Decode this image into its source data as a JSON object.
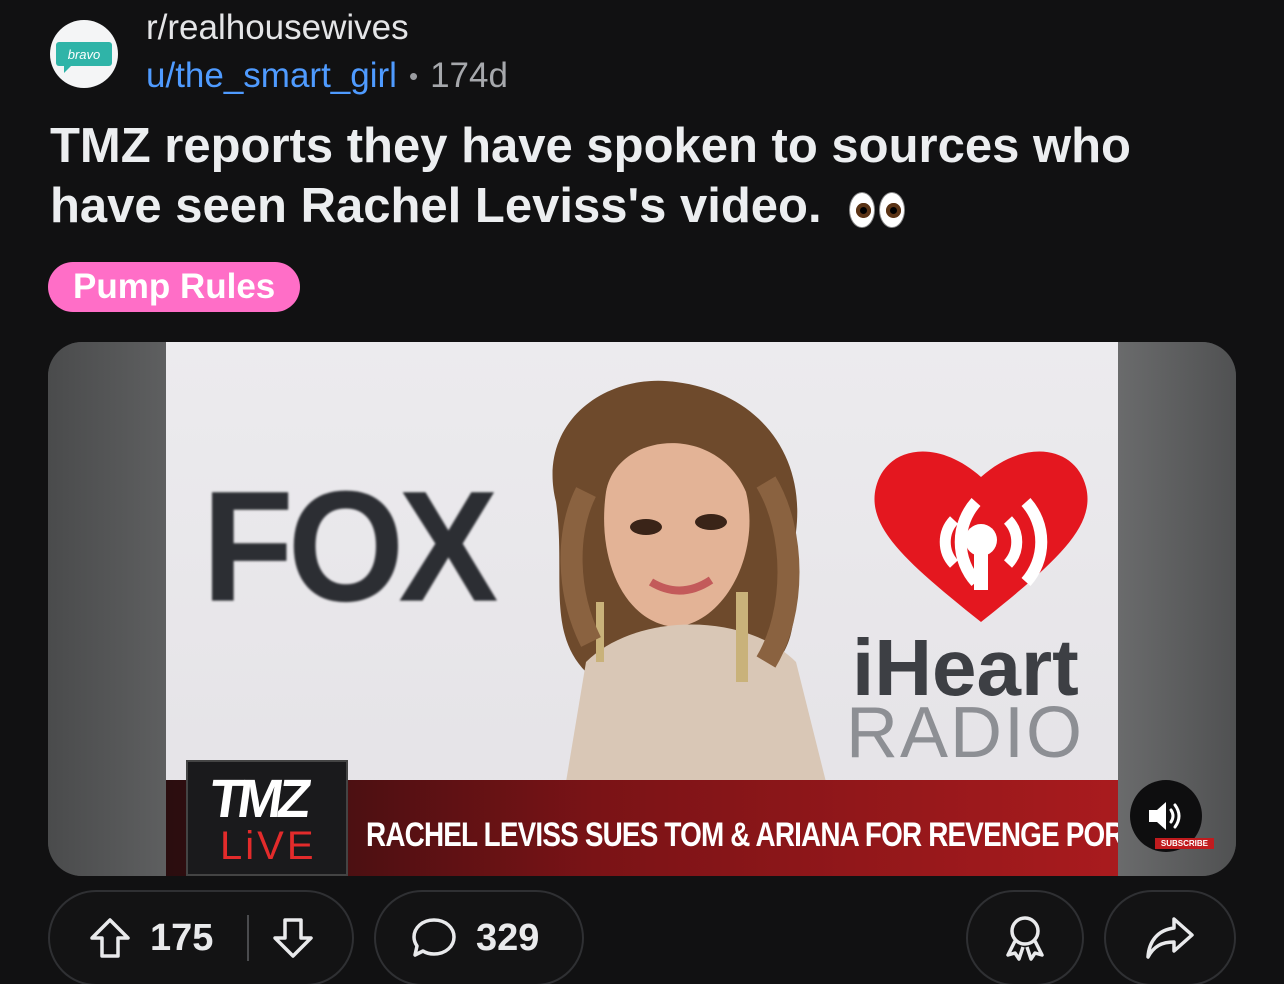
{
  "post": {
    "subreddit": "r/realhousewives",
    "author": "u/the_smart_girl",
    "separator": "•",
    "age": "174d",
    "avatar_text": "bravo",
    "title": "TMZ reports they have spoken to sources who have seen Rachel Leviss's video.",
    "title_emoji": "eyes-emoji",
    "flair": "Pump Rules"
  },
  "media": {
    "brand_left": "FOX",
    "brand_right_1": "iHeart",
    "brand_right_2": "RADIO",
    "tmz_logo": "TMZ",
    "tmz_live": "LiVE",
    "headline": "RACHEL LEVISS SUES TOM & ARIANA FOR REVENGE PORN",
    "subscribe": "SUBSCRIBE",
    "sound_icon": "speaker-icon"
  },
  "actions": {
    "upvotes": "175",
    "comments": "329",
    "upvote_icon": "upvote-arrow-icon",
    "downvote_icon": "downvote-arrow-icon",
    "comment_icon": "comment-bubble-icon",
    "award_icon": "award-icon",
    "share_icon": "share-arrow-icon"
  },
  "colors": {
    "background": "#111112",
    "link_blue": "#4f9bff",
    "flair_pink": "#ff6ec7",
    "tmz_red": "#a91b1e",
    "iheart_red": "#e4171f"
  }
}
